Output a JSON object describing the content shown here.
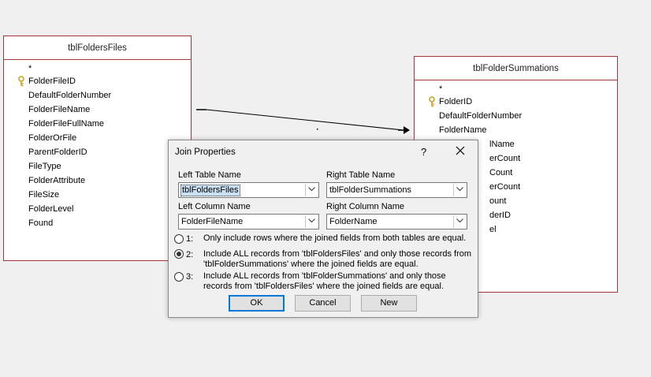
{
  "left_table": {
    "title": "tblFoldersFiles",
    "fields": [
      "*",
      "FolderFileID",
      "DefaultFolderNumber",
      "FolderFileName",
      "FolderFileFullName",
      "FolderOrFile",
      "ParentFolderID",
      "FileType",
      "FolderAttribute",
      "FileSize",
      "FolderLevel",
      "Found"
    ]
  },
  "right_table": {
    "title": "tblFolderSummations",
    "fields": [
      "*",
      "FolderID",
      "DefaultFolderNumber",
      "FolderName",
      "lName",
      "erCount",
      "Count",
      "erCount",
      "ount",
      "derID",
      "el"
    ]
  },
  "dialog": {
    "title": "Join Properties",
    "help": "?",
    "left_table_label": "Left Table Name",
    "right_table_label": "Right Table Name",
    "left_table_value": "tblFoldersFiles",
    "right_table_value": "tblFolderSummations",
    "left_column_label": "Left Column Name",
    "right_column_label": "Right Column Name",
    "left_column_value": "FolderFileName",
    "right_column_value": "FolderName",
    "options": [
      {
        "num": "1:",
        "text": "Only include rows where the joined fields from both tables are equal.",
        "checked": false
      },
      {
        "num": "2:",
        "text": "Include ALL records from 'tblFoldersFiles' and only those records from 'tblFolderSummations' where the joined fields are equal.",
        "checked": true
      },
      {
        "num": "3:",
        "text": "Include ALL records from 'tblFolderSummations' and only those records from 'tblFoldersFiles' where the joined fields are equal.",
        "checked": false
      }
    ],
    "ok_label": "OK",
    "cancel_label": "Cancel",
    "new_label": "New"
  }
}
